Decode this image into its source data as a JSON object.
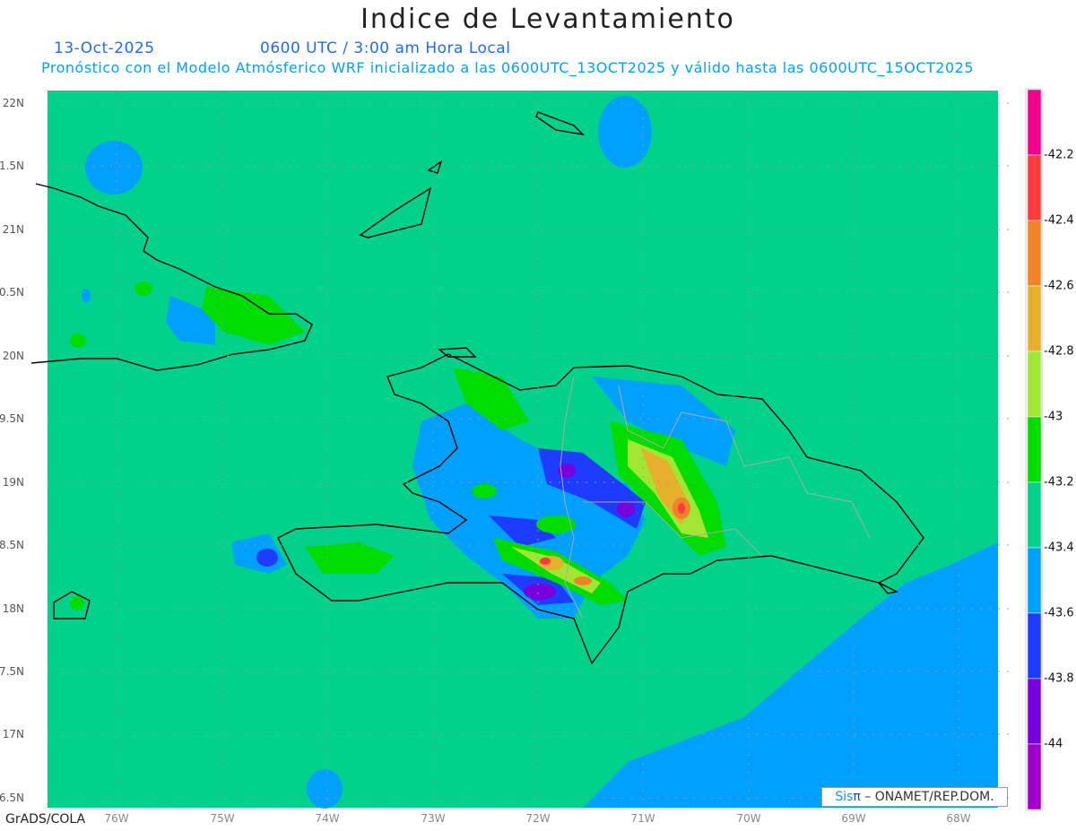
{
  "title": "Indice de Levantamiento",
  "date": "13-Oct-2025",
  "time": "0600 UTC / 3:00 am Hora Local",
  "description": "Pronóstico con el Modelo Atmósferico WRF inicializado a las 0600UTC_13OCT2025 y válido hasta las  0600UTC_15OCT2025",
  "lat_labels": [
    "22N",
    "1.5N",
    "21N",
    "0.5N",
    "20N",
    "9.5N",
    "19N",
    "8.5N",
    "18N",
    "7.5N",
    "17N",
    "6.5N"
  ],
  "lon_labels": [
    "76W",
    "75W",
    "74W",
    "73W",
    "72W",
    "71W",
    "70W",
    "69W",
    "68W"
  ],
  "colorbar": {
    "labels": [
      "-42.2",
      "-42.4",
      "-42.6",
      "-42.8",
      "-43",
      "-43.2",
      "-43.4",
      "-43.6",
      "-43.8",
      "-44"
    ],
    "colors": [
      "#f0008c",
      "#fa3c3c",
      "#f08228",
      "#e6af2d",
      "#a0e632",
      "#00dc00",
      "#00d28c",
      "#00a0ff",
      "#1e3cff",
      "#7800dc",
      "#a000c8"
    ]
  },
  "credit": {
    "brand_a": "Sis",
    "brand_b": "π",
    "text": " – ONAMET/REP.DOM."
  },
  "footer": "GrADS/COLA"
}
